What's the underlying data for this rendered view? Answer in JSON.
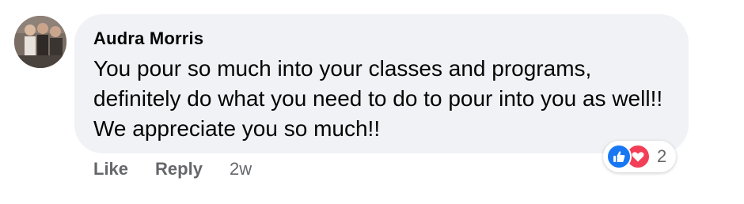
{
  "comment": {
    "author": "Audra Morris",
    "text": "You pour so much into your classes and programs, definitely do what you need to do to pour into you as well!! We appreciate you so much!!",
    "avatar_icon": "user-avatar-photo"
  },
  "reactions": {
    "icons": [
      "like-icon",
      "love-icon"
    ],
    "count": "2",
    "like_color": "#1877f2",
    "love_color": "#f33e58"
  },
  "actions": {
    "like_label": "Like",
    "reply_label": "Reply",
    "timestamp": "2w"
  },
  "colors": {
    "bubble_bg": "#f0f2f5",
    "secondary_text": "#65676b",
    "primary_text": "#050505"
  }
}
